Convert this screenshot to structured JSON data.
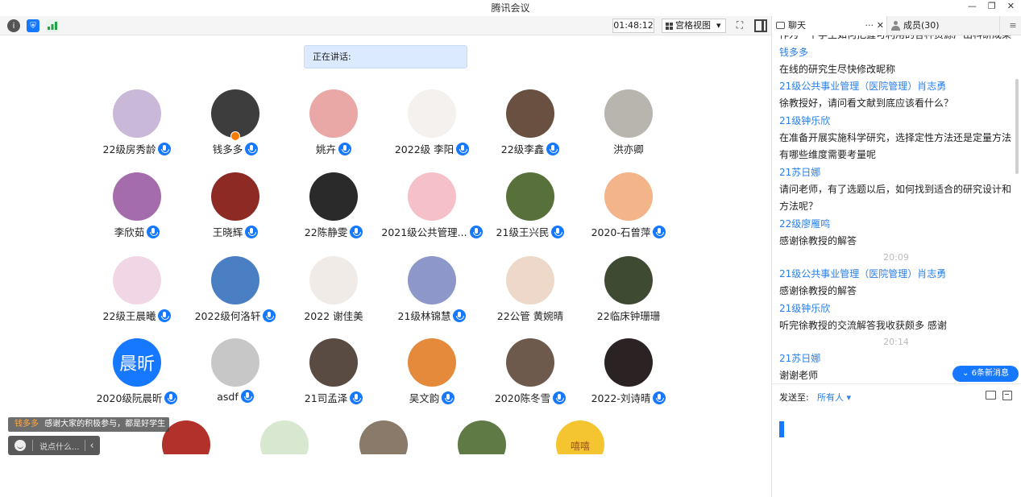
{
  "window": {
    "title": "腾讯会议",
    "controls": [
      "—",
      "❐",
      "✕"
    ]
  },
  "toolbar": {
    "timer": "01:48:12",
    "view_label": "宫格视图",
    "view_caret": "▾",
    "fullscreen_glyph": "⛶",
    "colors": {
      "info": "#555555",
      "shield": "#1677ff",
      "signal": "#22a34a"
    }
  },
  "speaking": {
    "label": "正在讲话:"
  },
  "participants": [
    {
      "name": "22级房秀龄",
      "bg": "#c9b8d8",
      "mic": true
    },
    {
      "name": "钱多多",
      "bg": "#3d3d3d",
      "mic": true,
      "host": true
    },
    {
      "name": "姚卉",
      "bg": "#e9a7a6",
      "mic": true
    },
    {
      "name": "2022级  李阳",
      "bg": "#f4f1ee",
      "mic": true
    },
    {
      "name": "22级李鑫",
      "bg": "#6a5040",
      "mic": true
    },
    {
      "name": "洪亦卿",
      "bg": "#b8b4ae",
      "mic": false
    },
    {
      "name": "李欣茹",
      "bg": "#a56cab",
      "mic": true
    },
    {
      "name": "王晓辉",
      "bg": "#8c2a23",
      "mic": true
    },
    {
      "name": "22陈静雯",
      "bg": "#2a2a2a",
      "mic": true
    },
    {
      "name": "2021级公共管理...",
      "bg": "#f5c0c8",
      "mic": true
    },
    {
      "name": "21级王兴民",
      "bg": "#58703a",
      "mic": true
    },
    {
      "name": "2020-石曾萍",
      "bg": "#f3b48a",
      "mic": true
    },
    {
      "name": "22级王晨曦",
      "bg": "#f1d6e6",
      "mic": true
    },
    {
      "name": "2022级何洛轩",
      "bg": "#4a7fc4",
      "mic": true
    },
    {
      "name": "2022 谢佳美",
      "bg": "#f0ebe6",
      "mic": false
    },
    {
      "name": "21级林锦慧",
      "bg": "#8e97c9",
      "mic": true
    },
    {
      "name": "22公管 黄婉晴",
      "bg": "#eed8ca",
      "mic": false
    },
    {
      "name": "22临床钟珊珊",
      "bg": "#3e4a32",
      "mic": false
    },
    {
      "name": "2020级阮晨昕",
      "bg": "#1677ff",
      "mic": true,
      "text": "晨昕"
    },
    {
      "name": "asdf",
      "bg": "#c7c7c7",
      "mic": true
    },
    {
      "name": "21司孟泽",
      "bg": "#5a4b42",
      "mic": true
    },
    {
      "name": "吴文韵",
      "bg": "#e48a3a",
      "mic": true
    },
    {
      "name": "2020陈冬雪",
      "bg": "#6d5a4d",
      "mic": true
    },
    {
      "name": "2022-刘诗晴",
      "bg": "#2b2224",
      "mic": true
    }
  ],
  "partial_row": [
    {
      "bg": "#b3312b"
    },
    {
      "bg": "#d8e8d0"
    },
    {
      "bg": "#8a7a6a"
    },
    {
      "bg": "#5f7a45"
    },
    {
      "bg": "#f4c431",
      "text": "嘻嘻"
    }
  ],
  "danmu": {
    "sender": "钱多多",
    "text": "感谢大家的积极参与，都是好学生"
  },
  "quick_chat": {
    "placeholder": "说点什么...",
    "collapse": "‹"
  },
  "panel": {
    "tab_chat": "聊天",
    "tab_members": "成员(30)",
    "tab_chat_more": "···",
    "tab_chat_close": "✕",
    "tab_menu": "≡",
    "messages": [
      {
        "type": "text",
        "text": "作为一个学生如何把握可利用的各种资源产出科研成果"
      },
      {
        "type": "name",
        "text": "钱多多"
      },
      {
        "type": "text",
        "text": "在线的研究生尽快修改昵称"
      },
      {
        "type": "name",
        "text": "21级公共事业管理（医院管理）肖志勇"
      },
      {
        "type": "text",
        "text": "徐教授好，请问看文献到底应该看什么？"
      },
      {
        "type": "name",
        "text": "21级钟乐欣"
      },
      {
        "type": "text",
        "text": "在准备开展实施科学研究，选择定性方法还是定量方法有哪些维度需要考量呢"
      },
      {
        "type": "name",
        "text": "21苏日娜"
      },
      {
        "type": "text",
        "text": "请问老师，有了选题以后，如何找到适合的研究设计和方法呢？"
      },
      {
        "type": "name",
        "text": "22级廖雁鸣"
      },
      {
        "type": "text",
        "text": "感谢徐教授的解答"
      },
      {
        "type": "time",
        "text": "20:09"
      },
      {
        "type": "name",
        "text": "21级公共事业管理（医院管理）肖志勇"
      },
      {
        "type": "text",
        "text": "感谢徐教授的解答"
      },
      {
        "type": "name",
        "text": "21级钟乐欣"
      },
      {
        "type": "text",
        "text": "听完徐教授的交流解答我收获颇多 感谢"
      },
      {
        "type": "time",
        "text": "20:14"
      },
      {
        "type": "name",
        "text": "21苏日娜"
      },
      {
        "type": "text",
        "text": "谢谢老师"
      }
    ],
    "new_messages": "⌄ 6条新消息",
    "send_to_label": "发送至:",
    "send_to_value": "所有人 ▾"
  }
}
